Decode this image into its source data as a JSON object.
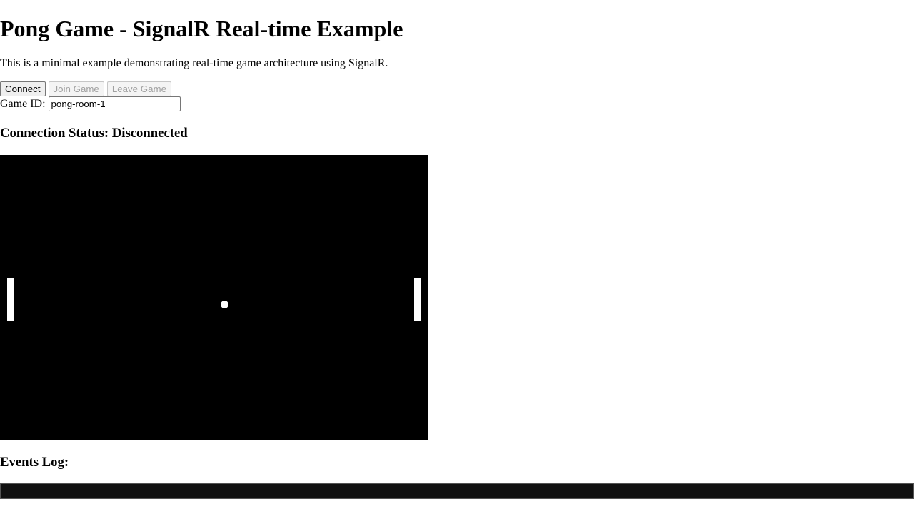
{
  "page": {
    "title": "Pong Game - SignalR Real-time Example",
    "description": "This is a minimal example demonstrating real-time game architecture using SignalR."
  },
  "controls": {
    "connect_label": "Connect",
    "join_label": "Join Game",
    "leave_label": "Leave Game",
    "game_id_label": "Game ID:",
    "game_id_value": "pong-room-1"
  },
  "status": {
    "text": "Connection Status: Disconnected"
  },
  "game": {
    "canvas_color": "#000000",
    "element_color": "#ffffff"
  },
  "log": {
    "title": "Events Log:",
    "entries": []
  }
}
